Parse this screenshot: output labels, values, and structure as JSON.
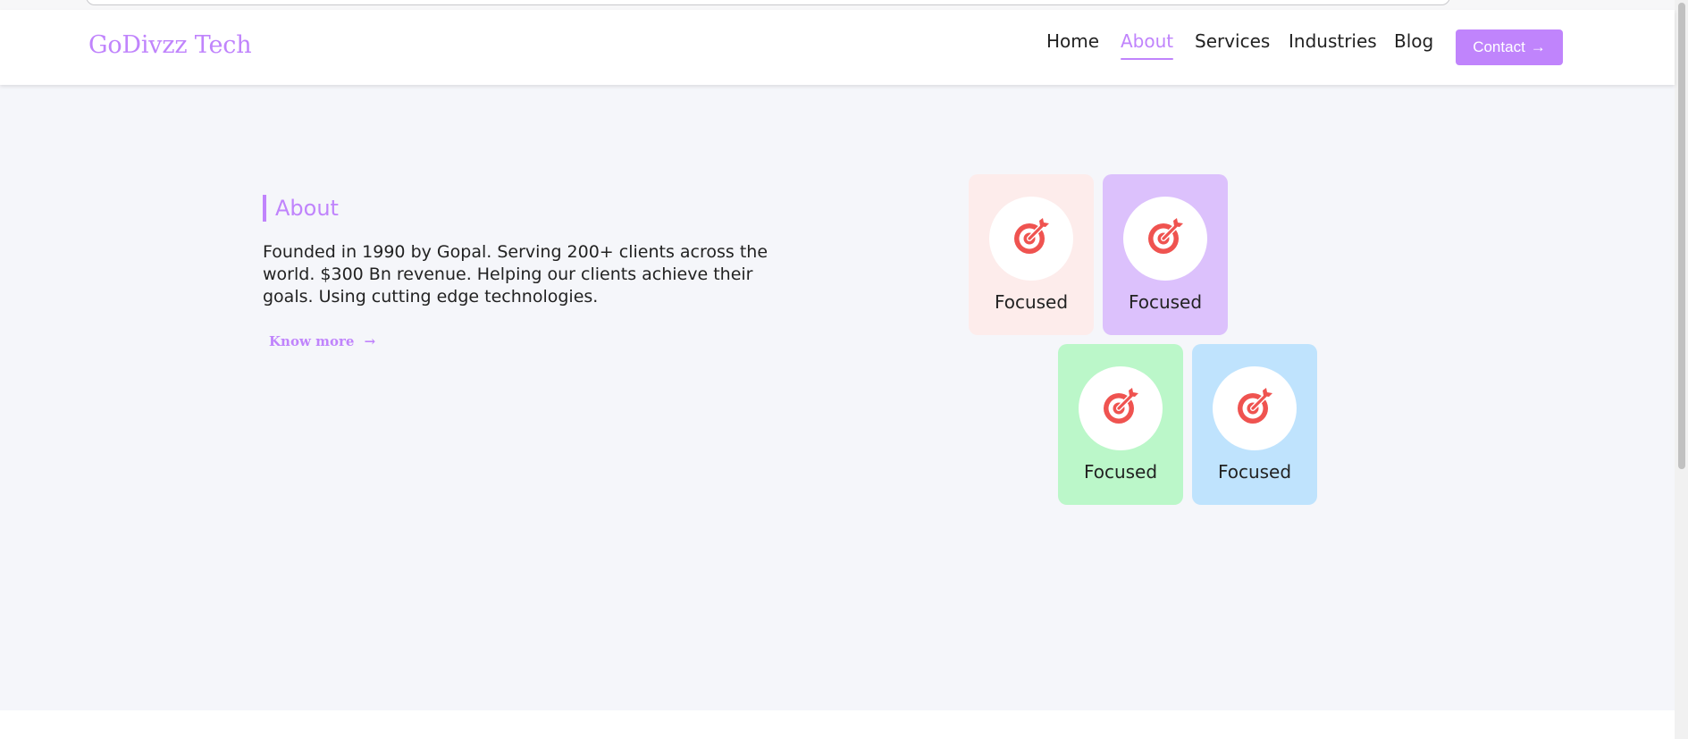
{
  "header": {
    "brand": "GoDivzz Tech",
    "nav": [
      {
        "label": "Home",
        "active": false
      },
      {
        "label": "About",
        "active": true
      },
      {
        "label": "Services",
        "active": false
      },
      {
        "label": "Industries",
        "active": false
      },
      {
        "label": "Blog",
        "active": false
      }
    ],
    "contact_label": "Contact",
    "contact_icon": "→"
  },
  "about": {
    "heading": "About",
    "text": "Founded in 1990 by Gopal. Serving 200+ clients across the world. $300 Bn revenue. Helping our clients achieve their goals. Using cutting edge technologies.",
    "know_more_label": "Know more",
    "know_more_icon": "→"
  },
  "features": [
    {
      "label": "Focused",
      "icon": "target-icon",
      "bg": "#fdeceb"
    },
    {
      "label": "Focused",
      "icon": "target-icon",
      "bg": "#dcc1fc"
    },
    {
      "label": "Focused",
      "icon": "target-icon",
      "bg": "#bbf7c9"
    },
    {
      "label": "Focused",
      "icon": "target-icon",
      "bg": "#bfe3fd"
    }
  ],
  "colors": {
    "accent": "#c084fc",
    "page_bg": "#f5f6fa",
    "icon_red": "#ef5350"
  }
}
